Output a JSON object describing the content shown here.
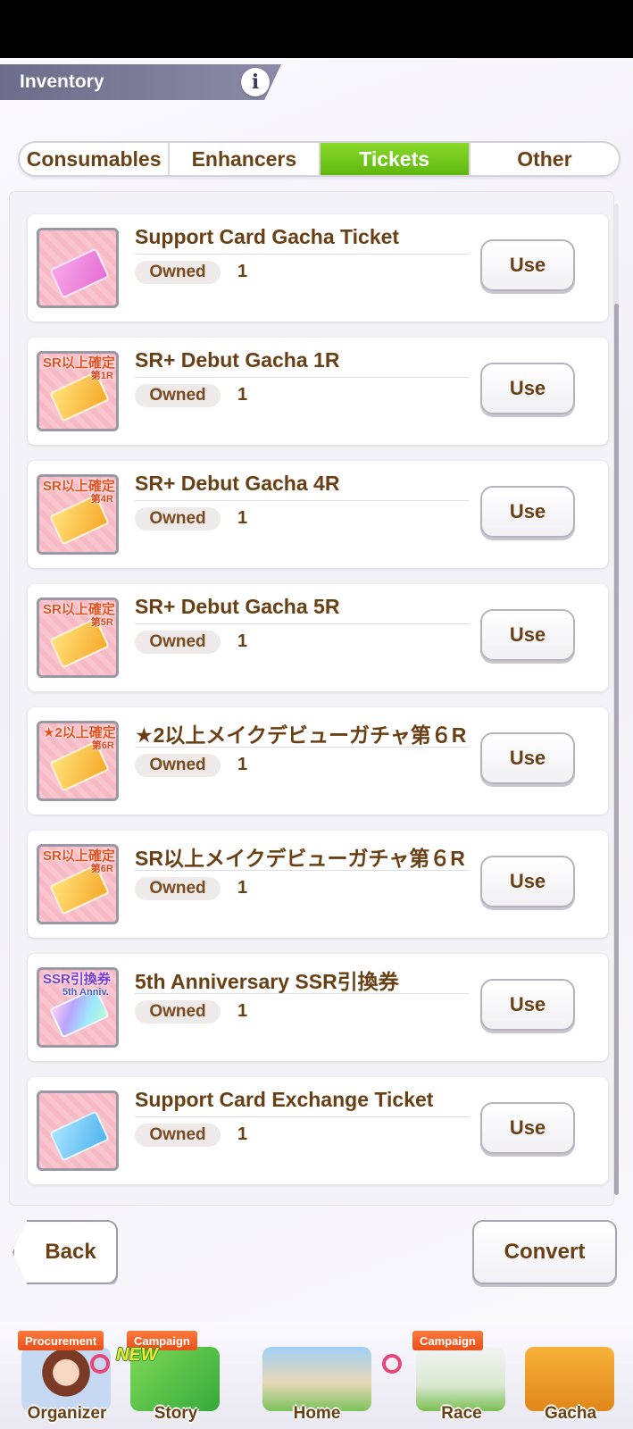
{
  "header": {
    "title": "Inventory"
  },
  "tabs": [
    {
      "label": "Consumables",
      "active": false
    },
    {
      "label": "Enhancers",
      "active": false
    },
    {
      "label": "Tickets",
      "active": true
    },
    {
      "label": "Other",
      "active": false
    }
  ],
  "owned_label": "Owned",
  "use_label": "Use",
  "items": [
    {
      "name": "Support Card Gacha Ticket",
      "owned": "1",
      "thumb_text": "",
      "thumb_sub": "",
      "ticket": "pink-ticket"
    },
    {
      "name": "SR+ Debut Gacha 1R",
      "owned": "1",
      "thumb_text": "SR以上確定",
      "thumb_sub": "第1R",
      "ticket": "gold-ticket"
    },
    {
      "name": "SR+ Debut Gacha 4R",
      "owned": "1",
      "thumb_text": "SR以上確定",
      "thumb_sub": "第4R",
      "ticket": "gold-ticket"
    },
    {
      "name": "SR+ Debut Gacha 5R",
      "owned": "1",
      "thumb_text": "SR以上確定",
      "thumb_sub": "第5R",
      "ticket": "gold-ticket"
    },
    {
      "name": "★2以上メイクデビューガチャ第６R",
      "owned": "1",
      "thumb_text": "★2以上確定",
      "thumb_sub": "第6R",
      "ticket": "gold-ticket"
    },
    {
      "name": "SR以上メイクデビューガチャ第６R",
      "owned": "1",
      "thumb_text": "SR以上確定",
      "thumb_sub": "第6R",
      "ticket": "gold-ticket"
    },
    {
      "name": "5th Anniversary SSR引換券",
      "owned": "1",
      "thumb_text": "SSR引換券",
      "thumb_sub": "5th Anniv.",
      "ticket": "rainbow-ticket"
    },
    {
      "name": "Support Card Exchange Ticket",
      "owned": "1",
      "thumb_text": "",
      "thumb_sub": "",
      "ticket": "blue-ticket"
    }
  ],
  "buttons": {
    "back": "Back",
    "convert": "Convert"
  },
  "nav": {
    "organizer": {
      "label": "Organizer",
      "badge": "Procurement"
    },
    "story": {
      "label": "Story",
      "badge": "Campaign",
      "tag": "NEW"
    },
    "home": {
      "label": "Home"
    },
    "race": {
      "label": "Race",
      "badge": "Campaign"
    },
    "gacha": {
      "label": "Gacha"
    }
  }
}
